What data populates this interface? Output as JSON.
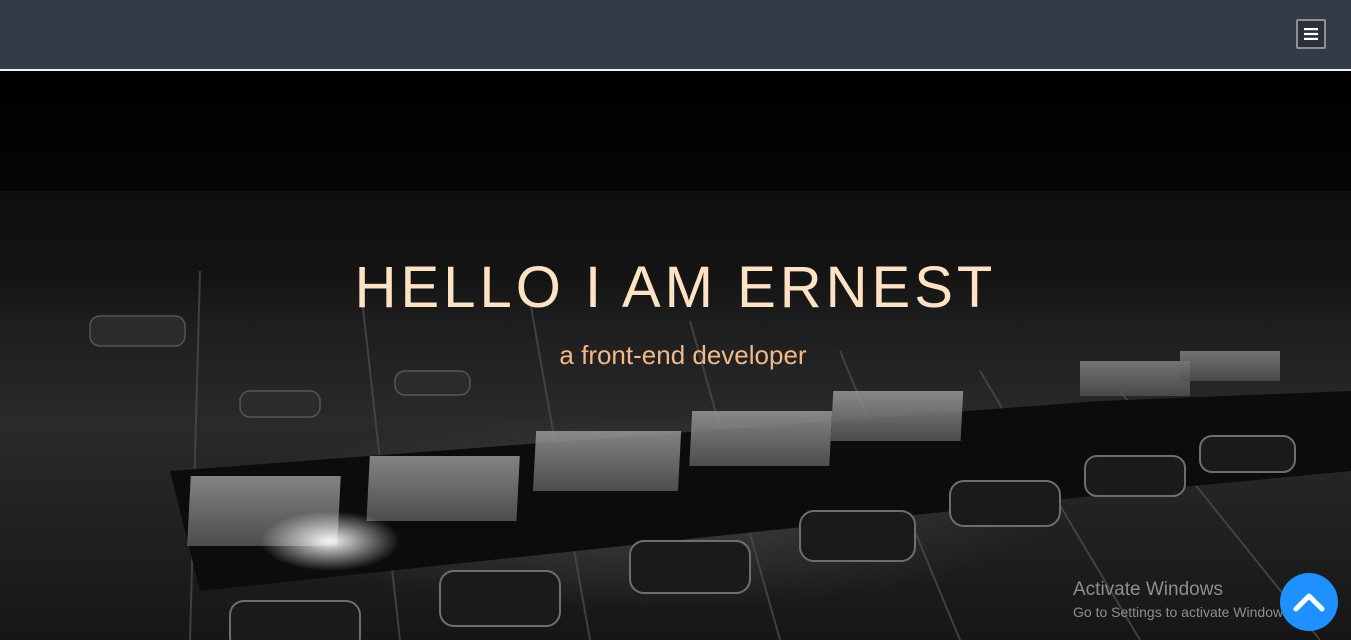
{
  "navbar": {
    "menu_icon": "hamburger-menu-icon"
  },
  "hero": {
    "title": "HELLO I AM ERNEST",
    "subtitle": "a front-end developer"
  },
  "watermark": {
    "title": "Activate Windows",
    "subtitle": "Go to Settings to activate Windows."
  },
  "scroll_top": {
    "icon": "chevron-up-icon"
  },
  "colors": {
    "navbar": "#343a46",
    "title": "#fde2c4",
    "subtitle": "#f1b98a",
    "scroll_button": "#1e90ff"
  }
}
